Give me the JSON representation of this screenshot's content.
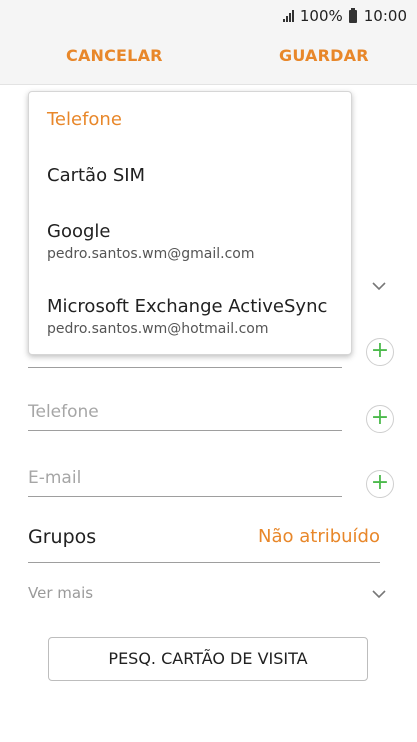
{
  "status": {
    "battery": "100%",
    "time": "10:00"
  },
  "actionbar": {
    "cancel": "CANCELAR",
    "save": "GUARDAR"
  },
  "fields": [
    {
      "placeholder": "Telefone"
    },
    {
      "placeholder": "E-mail"
    }
  ],
  "groups": {
    "label": "Grupos",
    "value": "Não atribuído"
  },
  "more": "Ver mais",
  "scan_button": "PESQ. CARTÃO DE VISITA",
  "popup": {
    "items": [
      {
        "title": "Telefone",
        "subtitle": ""
      },
      {
        "title": "Cartão SIM",
        "subtitle": ""
      },
      {
        "title": "Google",
        "subtitle": "pedro.santos.wm@gmail.com"
      },
      {
        "title": "Microsoft Exchange ActiveSync",
        "subtitle": "pedro.santos.wm@hotmail.com"
      }
    ],
    "selected": "Telefone"
  },
  "colors": {
    "accent": "#e8872a",
    "add": "#4cba4c"
  }
}
